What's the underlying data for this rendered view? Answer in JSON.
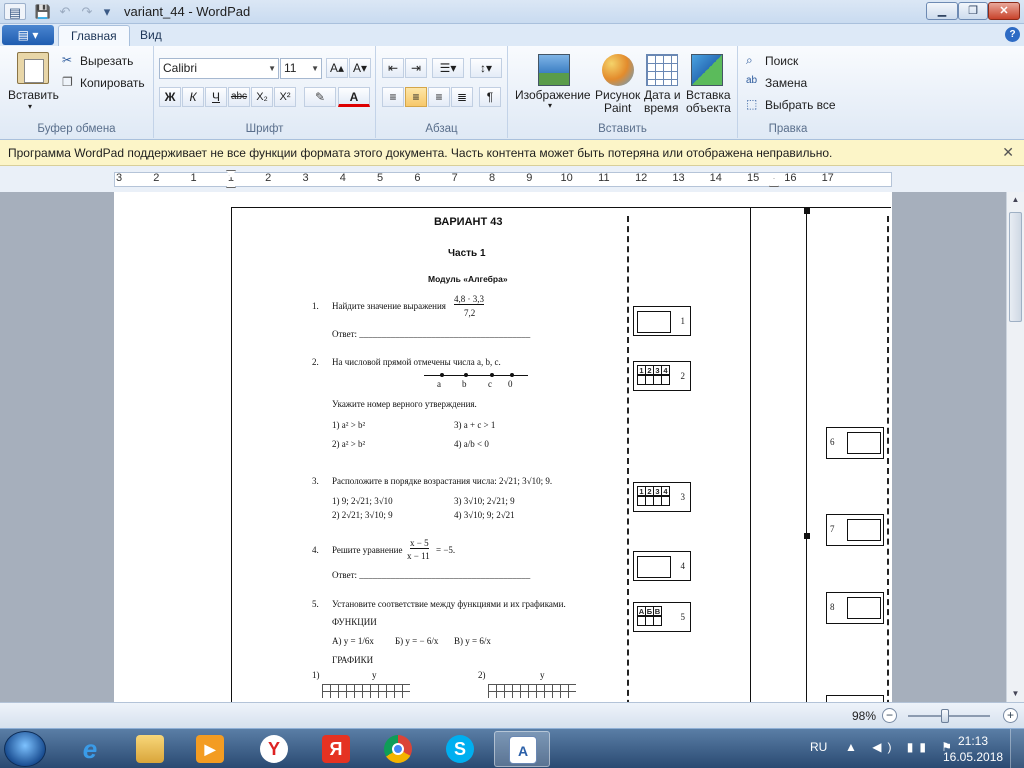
{
  "window": {
    "title": "variant_44 - WordPad",
    "minimize": "▁",
    "maximize": "❐",
    "close": "✕"
  },
  "quick_access": {
    "save_icon": "save-icon",
    "undo_icon": "undo-icon",
    "redo_icon": "redo-icon",
    "customize": "▾"
  },
  "tabs": {
    "file_menu": "▤ ▾",
    "home": "Главная",
    "view": "Вид",
    "help": "?"
  },
  "ribbon": {
    "clipboard": {
      "label": "Буфер обмена",
      "paste": "Вставить",
      "cut": "Вырезать",
      "copy": "Копировать"
    },
    "font": {
      "label": "Шрифт",
      "family": "Calibri",
      "size": "11",
      "grow": "A▴",
      "shrink": "A▾",
      "bold": "Ж",
      "italic": "К",
      "underline": "Ч",
      "strike": "abc",
      "subscript": "X₂",
      "superscript": "X²",
      "highlight": "✎",
      "color": "A"
    },
    "paragraph": {
      "label": "Абзац"
    },
    "insert": {
      "label": "Вставить",
      "image": "Изображение",
      "paint_1": "Рисунок",
      "paint_2": "Paint",
      "datetime_1": "Дата и",
      "datetime_2": "время",
      "object_1": "Вставка",
      "object_2": "объекта"
    },
    "edit": {
      "label": "Правка",
      "find": "Поиск",
      "replace": "Замена",
      "select_all": "Выбрать все"
    }
  },
  "infobar": {
    "text": "Программа WordPad поддерживает не все функции формата этого документа. Часть контента может быть потеряна или отображена неправильно.",
    "close": "✕"
  },
  "ruler": {
    "ticks": [
      "3",
      "2",
      "1",
      "1",
      "2",
      "3",
      "4",
      "5",
      "6",
      "7",
      "8",
      "9",
      "10",
      "11",
      "12",
      "13",
      "14",
      "15",
      "16",
      "17"
    ]
  },
  "scan": {
    "variant": "ВАРИАНТ 43",
    "part": "Часть 1",
    "module": "Модуль «Алгебра»",
    "q1_num": "1.",
    "q1_text": "Найдите значение выражения",
    "q1_frac_num": "4,8 · 3,3",
    "q1_frac_den": "7,2",
    "answer": "Ответ: ______________________________________",
    "q2_num": "2.",
    "q2_text": "На числовой прямой отмечены числа a, b, c.",
    "axis_a": "a",
    "axis_b": "b",
    "axis_c": "c",
    "axis_0": "0",
    "q2_prompt": "Укажите номер верного утверждения.",
    "q2_o1": "1) a² > b²",
    "q2_o2": "2) a² > b²",
    "q2_o3": "3) a + c > 1",
    "q2_o4": "4) a/b < 0",
    "q3_num": "3.",
    "q3_text": "Расположите в порядке возрастания числа: 2√21; 3√10; 9.",
    "q3_o1": "1)  9; 2√21; 3√10",
    "q3_o2": "2)  2√21; 3√10; 9",
    "q3_o3": "3)  3√10; 2√21; 9",
    "q3_o4": "4)  3√10; 9; 2√21",
    "q4_num": "4.",
    "q4_text": "Решите уравнение",
    "q4_frac_num": "x − 5",
    "q4_frac_den": "x − 11",
    "q4_rhs": "= −5.",
    "q5_num": "5.",
    "q5_text": "Установите соответствие между функциями и их графиками.",
    "functions": "ФУНКЦИИ",
    "f_a": "А) y = 1/6x",
    "f_b": "Б) y = − 6/x",
    "f_c": "В) y = 6/x",
    "graphs": "ГРАФИКИ",
    "g1": "1)",
    "g2": "2)",
    "y": "y",
    "box1": "1",
    "box2": "2",
    "box3": "3",
    "box4": "4",
    "box5": "5",
    "box6": "6",
    "box7": "7",
    "box8": "8",
    "cells4": [
      "1",
      "2",
      "3",
      "4"
    ],
    "cellsABV": [
      "А",
      "Б",
      "В"
    ]
  },
  "status": {
    "zoom": "98%",
    "zoom_out": "−",
    "zoom_in": "+",
    "zoom_fraction": 0.45
  },
  "taskbar": {
    "lang": "RU",
    "tray": "▲ ◀) ▮▮ ⚑",
    "time": "21:13",
    "date": "16.05.2018",
    "yandex": "Я",
    "yabrowser": "Y"
  }
}
